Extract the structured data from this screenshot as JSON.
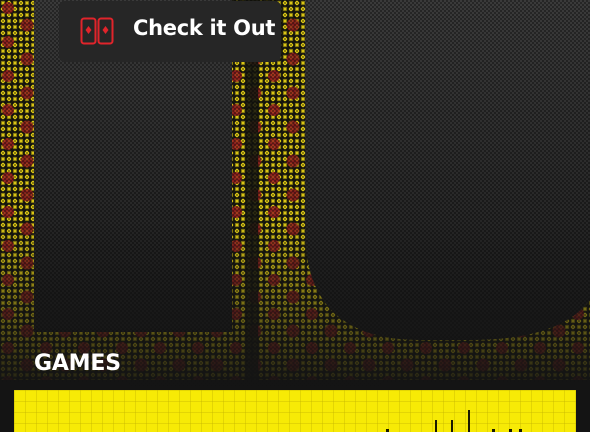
{
  "check_button": {
    "label": "Check it Out",
    "icon": "cards-icon",
    "icon_color": "#e0242b"
  },
  "section": {
    "title": "GAMES"
  },
  "colors": {
    "background": "#141414",
    "halftone_yellow": "#e8d21a",
    "dot_red": "#9c1f1f",
    "card_yellow": "#f7ea06",
    "button_bg": "#262626"
  }
}
